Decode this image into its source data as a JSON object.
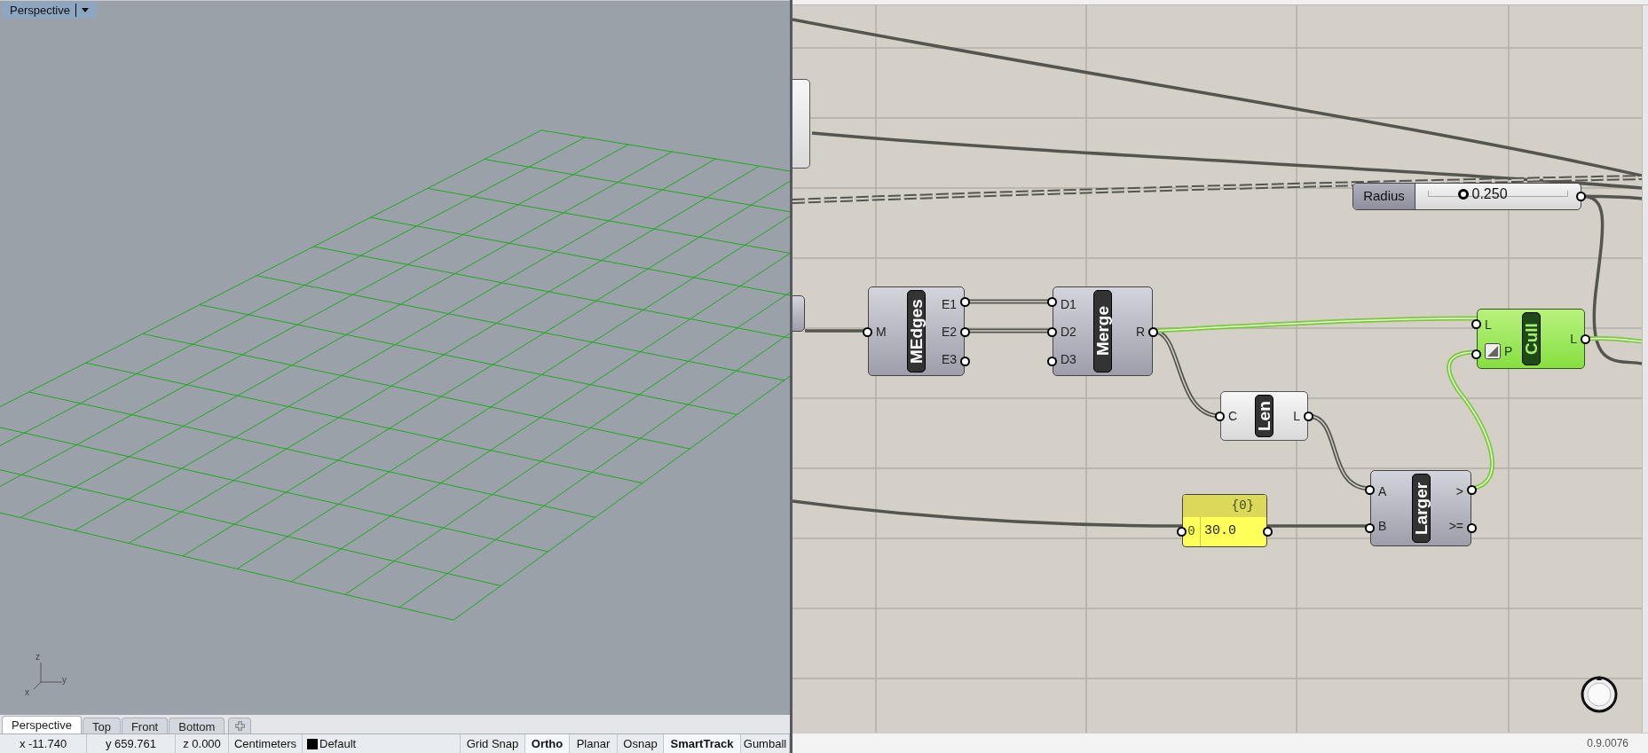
{
  "viewport": {
    "label": "Perspective",
    "axes": [
      "z",
      "x",
      "y"
    ],
    "tabs": [
      {
        "label": "Perspective",
        "selected": true
      },
      {
        "label": "Top",
        "selected": false
      },
      {
        "label": "Front",
        "selected": false
      },
      {
        "label": "Bottom",
        "selected": false
      }
    ]
  },
  "status_bar": {
    "coordinates": [
      "x -11.740",
      "y 659.761",
      "z 0.000"
    ],
    "units": "Centimeters",
    "layer": {
      "name": "Default",
      "color": "#000000"
    },
    "toggles": [
      {
        "label": "Grid Snap",
        "on": false
      },
      {
        "label": "Ortho",
        "on": true
      },
      {
        "label": "Planar",
        "on": false
      },
      {
        "label": "Osnap",
        "on": false
      },
      {
        "label": "SmartTrack",
        "on": true
      },
      {
        "label": "Gumball",
        "on": false
      }
    ]
  },
  "canvas": {
    "nodes": [
      {
        "name": "MEdges",
        "preview": true,
        "selected": false,
        "inputs": [
          {
            "label": "M",
            "inverted": false
          }
        ],
        "outputs": [
          "E1",
          "E2",
          "E3"
        ]
      },
      {
        "name": "Merge",
        "preview": true,
        "selected": false,
        "inputs": [
          {
            "label": "D1",
            "inverted": false
          },
          {
            "label": "D2",
            "inverted": false
          },
          {
            "label": "D3",
            "inverted": false
          }
        ],
        "outputs": [
          "R"
        ]
      },
      {
        "name": "Len",
        "preview": false,
        "selected": false,
        "inputs": [
          {
            "label": "C",
            "inverted": false
          }
        ],
        "outputs": [
          "L"
        ]
      },
      {
        "name": "Larger",
        "preview": true,
        "selected": false,
        "inputs": [
          {
            "label": "A",
            "inverted": false
          },
          {
            "label": "B",
            "inverted": false
          }
        ],
        "outputs": [
          ">",
          ">="
        ]
      },
      {
        "name": "Cull",
        "preview": true,
        "selected": true,
        "inputs": [
          {
            "label": "L",
            "inverted": false
          },
          {
            "label": "P",
            "inverted": true
          }
        ],
        "outputs": [
          "L"
        ]
      }
    ],
    "slider": {
      "label": "Radius",
      "value": "0.250",
      "level": 0.25
    },
    "panel": {
      "path": "{0}",
      "index": "0",
      "value": "30.0"
    },
    "version": "0.9.0076"
  }
}
